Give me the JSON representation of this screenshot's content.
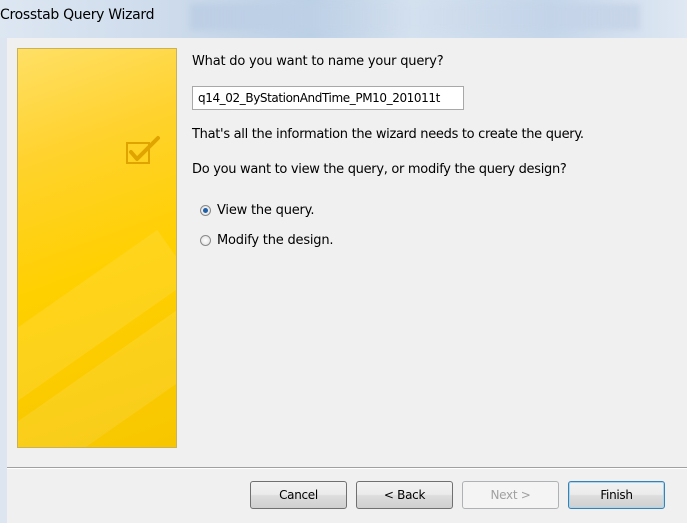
{
  "window": {
    "title": "Crosstab Query Wizard"
  },
  "main": {
    "question": "What do you want to name your query?",
    "query_name": "q14_02_ByStationAndTime_PM10_201011t",
    "info": "That's all the information the wizard needs to create the query.",
    "prompt": "Do you want to view the query, or modify the query design?",
    "options": [
      {
        "label": "View the query.",
        "selected": true
      },
      {
        "label": "Modify the design.",
        "selected": false
      }
    ]
  },
  "buttons": {
    "cancel": "Cancel",
    "back": "< Back",
    "next": "Next >",
    "finish": "Finish"
  },
  "colors": {
    "banner": "#ffd000",
    "accent": "#1f5fa8"
  }
}
